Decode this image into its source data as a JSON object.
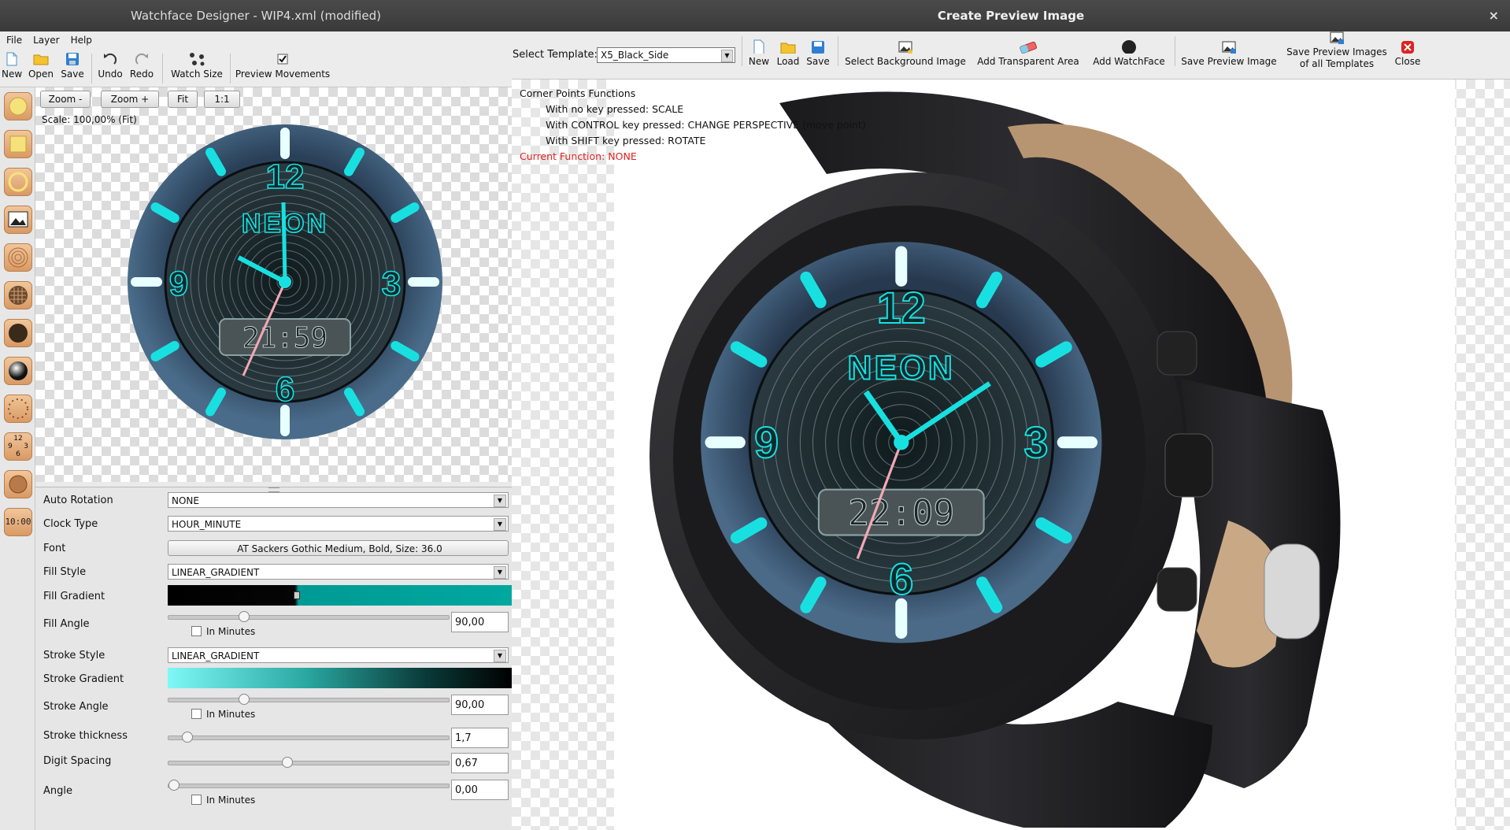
{
  "main": {
    "title": "Watchface Designer - WIP4.xml (modified)",
    "menu": [
      "File",
      "Layer",
      "Help"
    ],
    "toolbar": {
      "new": "New",
      "open": "Open",
      "save": "Save",
      "undo": "Undo",
      "redo": "Redo",
      "watch_size": "Watch Size",
      "preview_movements": "Preview Movements"
    },
    "zoom": {
      "zoom_out": "Zoom -",
      "zoom_in": "Zoom +",
      "fit": "Fit",
      "one_to_one": "1:1",
      "scale": "Scale:  100,00%  (Fit)"
    },
    "watch": {
      "num12": "12",
      "num3": "3",
      "num6": "6",
      "num9": "9",
      "brand": "NEON",
      "time": "21:59"
    },
    "left_tools": [
      "circle-tool-icon",
      "rectangle-tool-icon",
      "ring-tool-icon",
      "image-tool-icon",
      "spiral-tool-icon",
      "pattern-tool-icon",
      "dots-tool-icon",
      "sphere-tool-icon",
      "dial-ticks-tool-icon",
      "numbers-tool-icon",
      "hand-tool-icon",
      "digital-clock-tool-icon"
    ],
    "tool_numbers": {
      "n12": "12",
      "n9": "9",
      "n3": "3",
      "n6": "6"
    },
    "digital_tool_label": "10:00",
    "properties": {
      "auto_rotation": {
        "label": "Auto Rotation",
        "value": "NONE"
      },
      "clock_type": {
        "label": "Clock Type",
        "value": "HOUR_MINUTE"
      },
      "font": {
        "label": "Font",
        "value": "AT Sackers Gothic Medium, Bold, Size: 36.0"
      },
      "fill_style": {
        "label": "Fill Style",
        "value": "LINEAR_GRADIENT"
      },
      "fill_gradient": {
        "label": "Fill Gradient"
      },
      "fill_angle": {
        "label": "Fill Angle",
        "value": "90,00",
        "in_minutes": "In Minutes"
      },
      "stroke_style": {
        "label": "Stroke Style",
        "value": "LINEAR_GRADIENT"
      },
      "stroke_gradient": {
        "label": "Stroke Gradient"
      },
      "stroke_angle": {
        "label": "Stroke Angle",
        "value": "90,00",
        "in_minutes": "In Minutes"
      },
      "stroke_thickness": {
        "label": "Stroke thickness",
        "value": "1,7"
      },
      "digit_spacing": {
        "label": "Digit Spacing",
        "value": "0,67"
      },
      "angle": {
        "label": "Angle",
        "value": "0,00",
        "in_minutes": "In Minutes"
      }
    },
    "slider_levels": {
      "fill_angle": 0.26,
      "stroke_angle": 0.26,
      "stroke_thickness": 0.05,
      "digit_spacing": 0.42,
      "angle": 0.0
    }
  },
  "preview": {
    "title": "Create Preview Image",
    "close_x": "×",
    "select_template_label": "Select Template:",
    "template_value": "X5_Black_Side",
    "toolbar": {
      "new": "New",
      "load": "Load",
      "save": "Save",
      "select_bg": "Select Background Image",
      "add_transparent": "Add Transparent Area",
      "add_watchface": "Add WatchFace",
      "save_preview": "Save Preview Image",
      "save_all_1": "Save Preview Images",
      "save_all_2": "of all Templates",
      "close": "Close"
    },
    "info": {
      "heading": "Corner Points Functions",
      "line1": "With no key pressed: SCALE",
      "line2": "With CONTROL key pressed: CHANGE PERSPECTIVE (move point)",
      "line3": "With SHIFT key pressed: ROTATE",
      "current": "Current Function: NONE"
    },
    "watch": {
      "num12": "12",
      "num3": "3",
      "num6": "6",
      "num9": "9",
      "brand": "NEON",
      "time": "22:09"
    }
  },
  "colors": {
    "accent_cyan": "#19e0e0",
    "title_bg": "#3d3d3d",
    "current_function_red": "#e02020"
  }
}
